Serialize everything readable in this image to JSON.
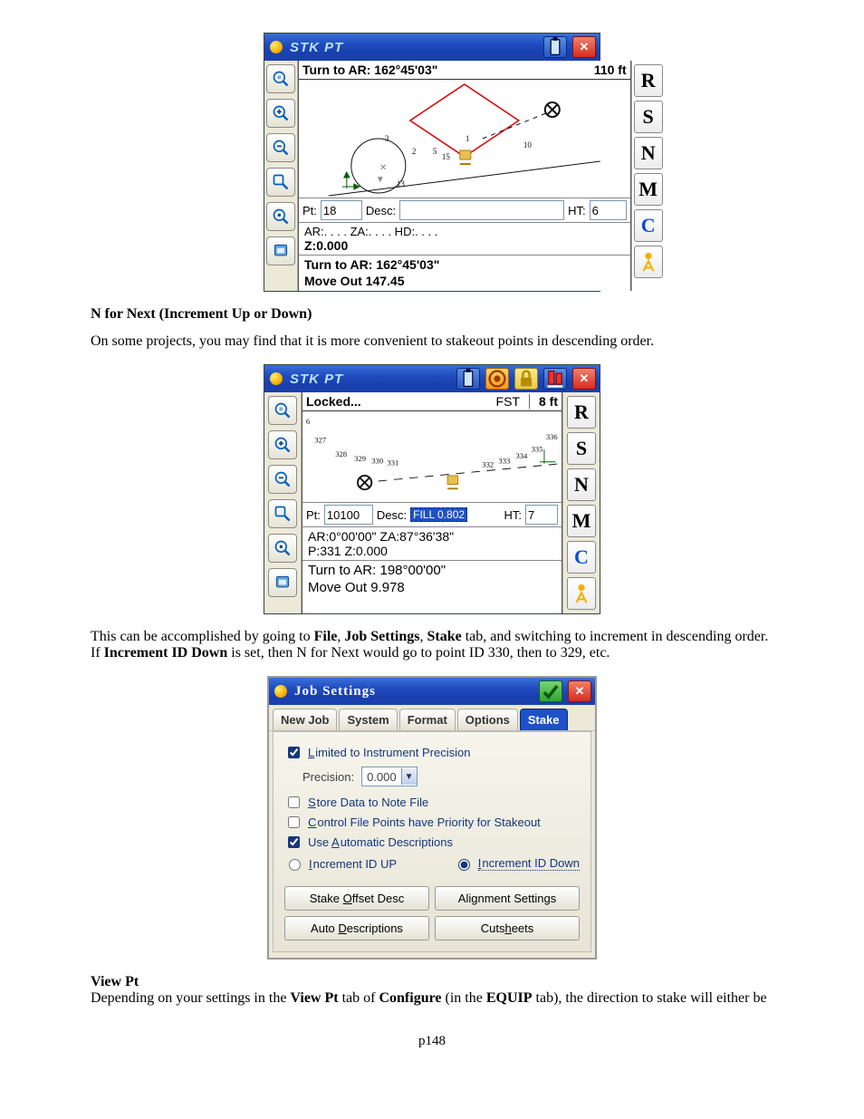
{
  "headings": {
    "n_for_next": "N for Next (Increment Up or Down)",
    "view_pt": "View Pt"
  },
  "paragraphs": {
    "desc_order": "On some projects, you may find that it is more convenient to stakeout points in descending order.",
    "job_settings_path_1": "This can be accomplished by going to ",
    "job_settings_path_2": " tab, and switching to increment in descending order.  If ",
    "job_settings_path_3": " is set, then N for Next would go to point ID 330, then to 329, etc.",
    "view_pt_body_1": "Depending on your settings in the ",
    "view_pt_body_2": " tab of ",
    "view_pt_body_3": " (in the ",
    "view_pt_body_4": " tab), the direction to stake will either be"
  },
  "strongs": {
    "file": "File",
    "job_settings": "Job Settings",
    "stake": "Stake",
    "increment_id_down": "Increment ID Down",
    "view_pt": "View Pt",
    "configure": "Configure",
    "equip": "EQUIP"
  },
  "dev1": {
    "title": "STK PT",
    "status_left": "Turn to AR: 162°45'03\"",
    "status_right": "110 ft",
    "pt_label": "Pt:",
    "pt_value": "18",
    "desc_label": "Desc:",
    "desc_value": "",
    "ht_label": "HT:",
    "ht_value": "6",
    "meas_line": "AR:. . . .      ZA:. . . .      HD:. . . .",
    "z_line": "Z:0.000",
    "instr1": "Turn to AR: 162°45'03\"",
    "instr2": "Move Out 147.45",
    "pts": [
      "1",
      "2",
      "3",
      "5",
      "10",
      "13",
      "15"
    ]
  },
  "dev2": {
    "title": "STK PT",
    "status_left": "Locked...",
    "status_mid": "FST",
    "status_right": "8 ft",
    "pt_label": "Pt:",
    "pt_value": "10100",
    "desc_label": "Desc:",
    "desc_value": "FILL 0.802",
    "ht_label": "HT:",
    "ht_value": "7",
    "meas_line": "AR:0°00'00\"    ZA:87°36'38\"",
    "p_line": "P:331 Z:0.000",
    "instr1": "Turn to AR: 198°00'00\"",
    "instr2": "Move Out 9.978",
    "pts": [
      "6",
      "327",
      "328",
      "329",
      "330",
      "331",
      "332",
      "333",
      "334",
      "335",
      "336"
    ]
  },
  "keys": {
    "R": "R",
    "S": "S",
    "N": "N",
    "M": "M",
    "C": "C",
    "A": "A"
  },
  "dlg": {
    "title": "Job Settings",
    "tabs": [
      "New Job",
      "System",
      "Format",
      "Options",
      "Stake"
    ],
    "active_tab": "Stake",
    "chk1_pre": "L",
    "chk1_rest": "imited to Instrument Precision",
    "precision_label": "Precision:",
    "precision_value": "0.000",
    "chk2_pre": "S",
    "chk2_rest": "tore Data to Note File",
    "chk3_pre": "C",
    "chk3_rest": "ontrol File Points have Priority for Stakeout",
    "chk4": "Use ",
    "chk4_u": "A",
    "chk4_rest": "utomatic Descriptions",
    "radio_up_pre": "I",
    "radio_up_rest": "ncrement ID UP",
    "radio_down_pre": "I",
    "radio_down_rest": "ncrement ID Down",
    "btn1": "Stake ",
    "btn1_u": "O",
    "btn1_r": "ffset Desc",
    "btn2": "Ali",
    "btn2_u": "g",
    "btn2_r": "nment Settings",
    "btn3": "Auto ",
    "btn3_u": "D",
    "btn3_r": "escriptions",
    "btn4": "Cuts",
    "btn4_u": "h",
    "btn4_r": "eets"
  },
  "page_number": "p148"
}
